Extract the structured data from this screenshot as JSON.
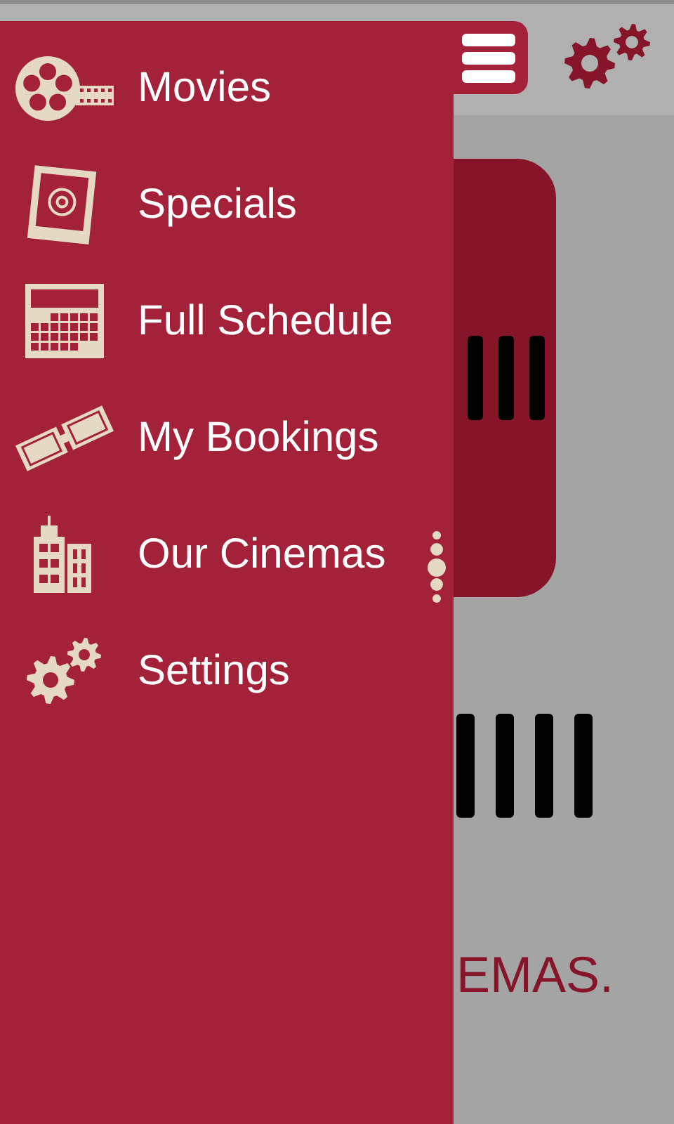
{
  "background": {
    "partial_text": "EMAS."
  },
  "drawer": {
    "items": [
      {
        "label": "Movies"
      },
      {
        "label": "Specials"
      },
      {
        "label": "Full Schedule"
      },
      {
        "label": "My Bookings"
      },
      {
        "label": "Our Cinemas"
      },
      {
        "label": "Settings"
      }
    ]
  }
}
